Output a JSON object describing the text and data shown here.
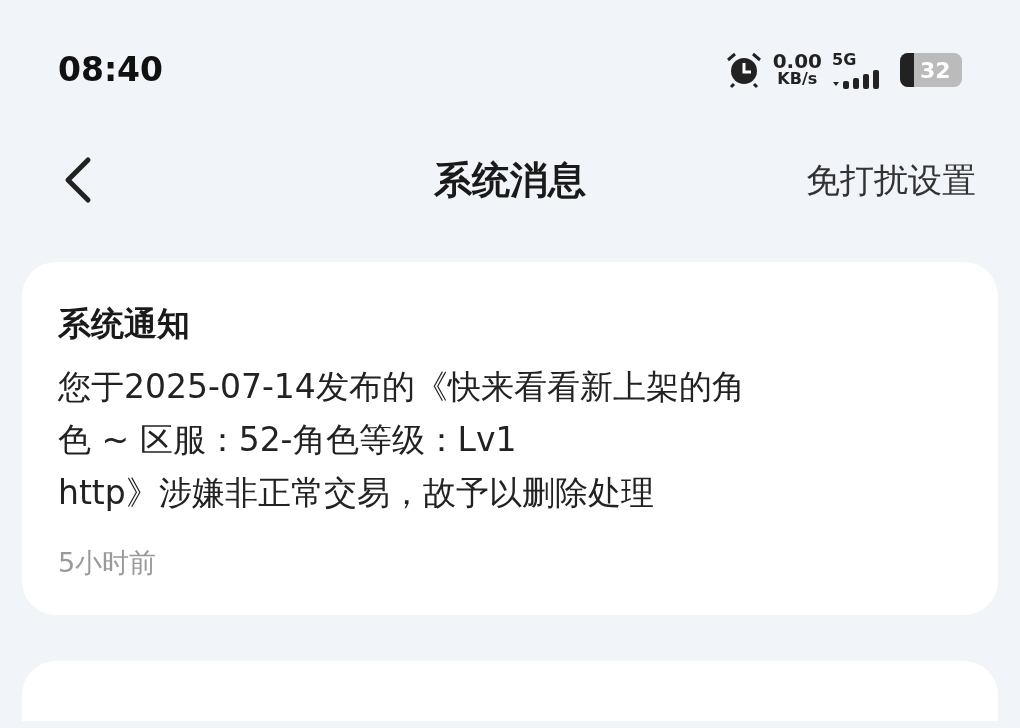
{
  "status_bar": {
    "time": "08:40",
    "alarm": true,
    "net_speed": "0.00",
    "net_speed_unit": "KB/s",
    "network": "5G",
    "battery": "32"
  },
  "header": {
    "title": "系统消息",
    "action": "免打扰设置"
  },
  "messages": [
    {
      "kind": "notice",
      "title": "系统通知",
      "body": "您于2025-07-14发布的《快来看看新上架的角色 ~ 区服：52-角色等级：Lv1\nhttp》涉嫌非正常交易，故予以删除处理",
      "time": "5小时前"
    },
    {
      "kind": "blank"
    }
  ]
}
